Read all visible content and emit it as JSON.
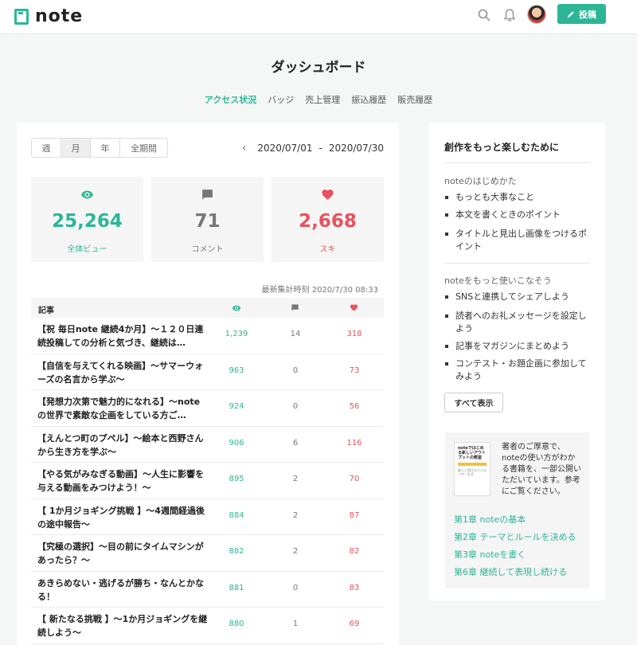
{
  "header": {
    "logo_text": "note",
    "post_label": "投稿",
    "icons": [
      "search-icon",
      "bell-icon",
      "avatar",
      "pencil-icon"
    ]
  },
  "page": {
    "title": "ダッシュボード",
    "tabs": [
      "アクセス状況",
      "バッジ",
      "売上管理",
      "振込履歴",
      "販売履歴"
    ],
    "active_tab": "アクセス状況"
  },
  "main": {
    "period_tabs": [
      "週",
      "月",
      "年",
      "全期間"
    ],
    "active_period": "月",
    "date_from": "2020/07/01",
    "date_sep": "-",
    "date_to": "2020/07/30",
    "stats": {
      "views": {
        "value": "25,264",
        "label": "全体ビュー",
        "icon": "eye-icon"
      },
      "comments": {
        "value": "71",
        "label": "コメント",
        "icon": "comment-icon"
      },
      "likes": {
        "value": "2,668",
        "label": "スキ",
        "icon": "heart-icon"
      }
    },
    "updated_at": "最新集計時刻 2020/7/30 08:33",
    "table": {
      "col_title": "記事",
      "rows": [
        {
          "title": "【祝 毎日note 継続4か月】～１２０日連続投稿しての分析と気づき、継続は…",
          "views": "1,239",
          "comments": "14",
          "likes": "318"
        },
        {
          "title": "【自信を与えてくれる映画】～サマーウォーズの名言から学ぶ～",
          "views": "963",
          "comments": "0",
          "likes": "73"
        },
        {
          "title": "【発想力次第で魅力的になれる】～noteの世界で素敵な企画をしている方ご…",
          "views": "924",
          "comments": "0",
          "likes": "56"
        },
        {
          "title": "【えんとつ町のプペル】～絵本と西野さんから生き方を学ぶ～",
          "views": "906",
          "comments": "6",
          "likes": "116"
        },
        {
          "title": "【やる気がみなぎる動画】～人生に影響を与える動画をみつけよう！～",
          "views": "895",
          "comments": "2",
          "likes": "70"
        },
        {
          "title": "【 1か月ジョギング挑戦 】～4週間経過後の途中報告～",
          "views": "884",
          "comments": "2",
          "likes": "87"
        },
        {
          "title": "【究極の選択】～目の前にタイムマシンがあったら？～",
          "views": "882",
          "comments": "2",
          "likes": "82"
        },
        {
          "title": "あきらめない・逃げるが勝ち・なんとかなる！",
          "views": "881",
          "comments": "0",
          "likes": "83"
        },
        {
          "title": "【 新たなる挑戦 】～1か月ジョギングを継続しよう～",
          "views": "880",
          "comments": "1",
          "likes": "69"
        }
      ]
    }
  },
  "side": {
    "title": "創作をもっと楽しむために",
    "section1": {
      "heading": "noteのはじめかた",
      "items": [
        "もっとも大事なこと",
        "本文を書くときのポイント",
        "タイトルと見出し画像をつけるポイント"
      ]
    },
    "section2": {
      "heading": "noteをもっと使いこなそう",
      "items": [
        "SNSと連携してシェアしよう",
        "読者へのお礼メッセージを設定しよう",
        "記事をマガジンにまとめよう",
        "コンテスト・お題企画に参加してみよう"
      ]
    },
    "show_all": "すべて表示",
    "book": {
      "cover_title": "noteではじめる新しいアウトプットの教室",
      "cover_sub": "楽しく続けるクリエイター生活",
      "description": "著者のご厚意で、noteの使い方がわかる書籍を、一部公開いただいています。参考にご覧ください。",
      "chapters": [
        "第1章 noteの基本",
        "第2章 テーマとルールを決める",
        "第3章 noteを書く",
        "第6章 継続して表現し続ける"
      ]
    }
  },
  "colors": {
    "accent": "#2cb696",
    "like": "#e8515d",
    "muted": "#777777"
  }
}
